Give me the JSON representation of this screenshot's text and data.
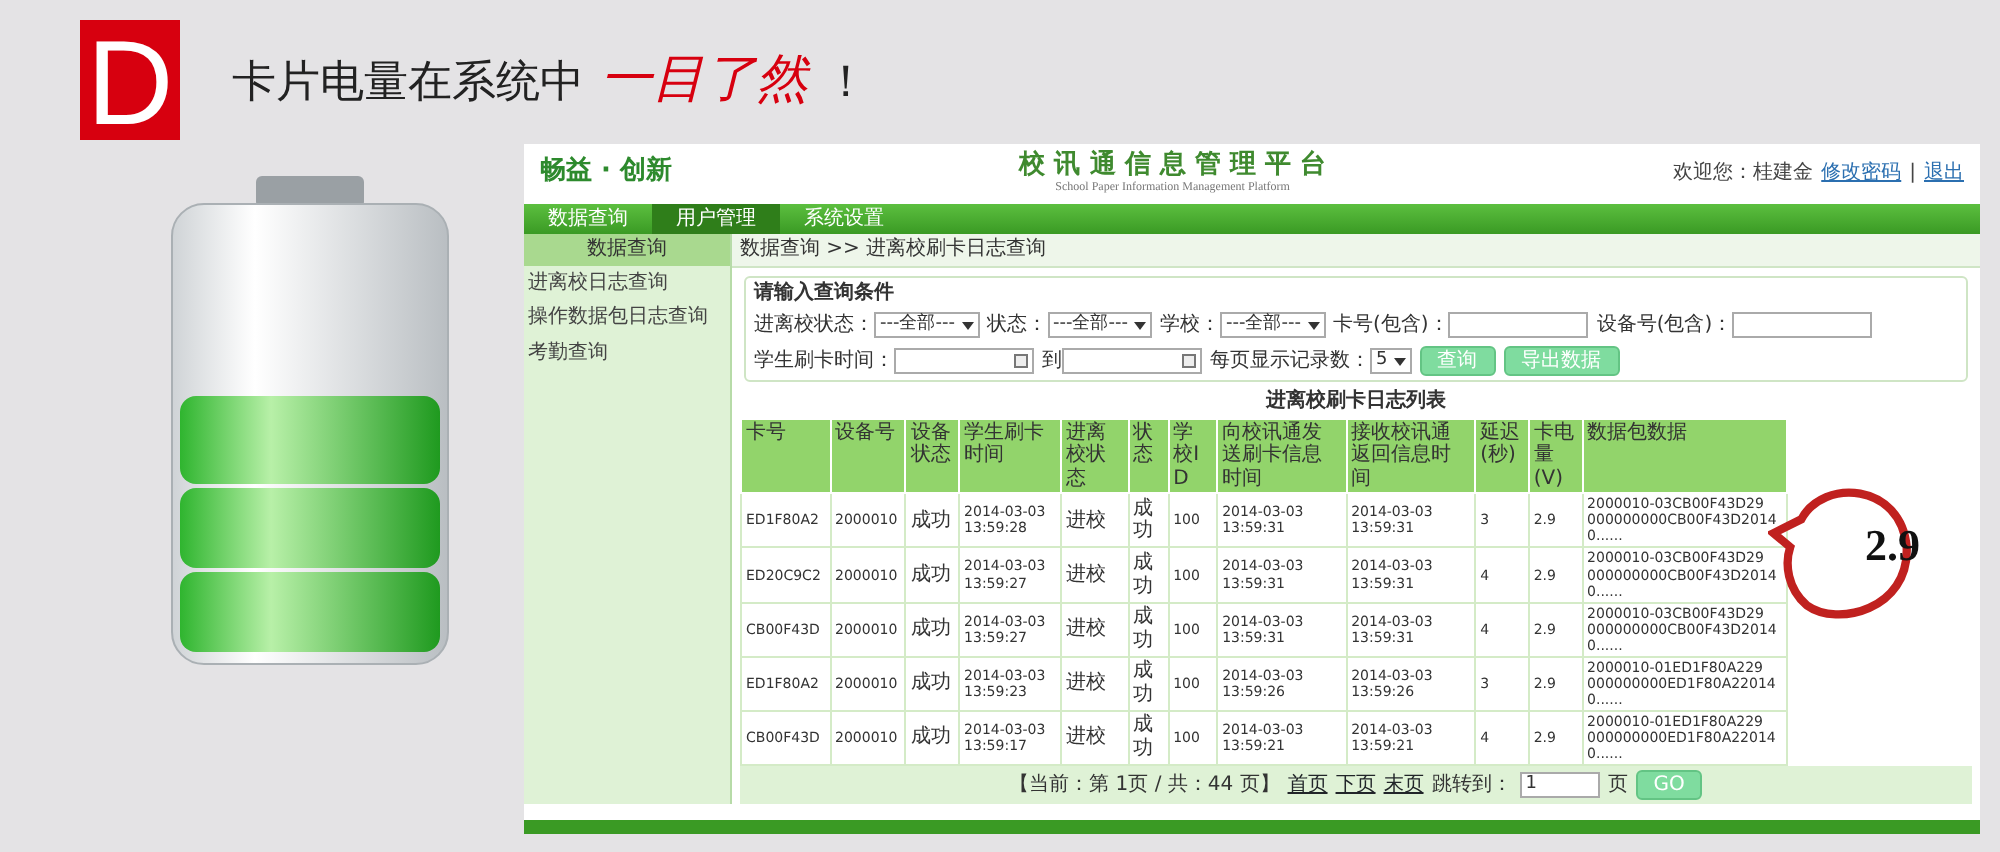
{
  "heading": {
    "badge": "D",
    "text": "卡片电量在系统中",
    "highlight": "一目了然",
    "end": "！"
  },
  "app": {
    "logo": "畅益 · 创新",
    "title": "校 讯 通 信 息 管 理 平 台",
    "subtitle": "School Paper Information Management Platform",
    "welcome": "欢迎您：桂建金",
    "links": [
      "修改密码",
      "退出"
    ],
    "separator": "|",
    "nav": [
      {
        "label": "数据查询",
        "selected": false
      },
      {
        "label": "用户管理",
        "selected": true
      },
      {
        "label": "系统设置",
        "selected": false
      }
    ],
    "sidebar": {
      "title": "数据查询",
      "items": [
        "进离校日志查询",
        "操作数据包日志查询",
        "考勤查询"
      ]
    },
    "breadcrumb": "数据查询 >> 进离校刷卡日志查询",
    "filter": {
      "legend": "请输入查询条件",
      "fields": [
        {
          "kind": "select",
          "label": "进离校状态：",
          "value": "---全部---"
        },
        {
          "kind": "select",
          "label": "状态：",
          "value": "---全部---"
        },
        {
          "kind": "select",
          "label": "学校：",
          "value": "---全部---"
        },
        {
          "kind": "input",
          "label": "卡号(包含)："
        },
        {
          "kind": "input",
          "label": "设备号(包含)："
        },
        {
          "kind": "date",
          "label": "学生刷卡时间："
        },
        {
          "kind": "date",
          "label": "到"
        },
        {
          "kind": "select",
          "label": "每页显示记录数：",
          "value": "5"
        }
      ],
      "buttons": [
        "查询",
        "导出数据"
      ]
    },
    "table": {
      "title": "进离校刷卡日志列表",
      "columns": [
        "卡号",
        "设备号",
        "设备状态",
        "学生刷卡时间",
        "进离校状态",
        "状态",
        "学校ID",
        "向校讯通发送刷卡信息时间",
        "接收校讯通返回信息时间",
        "延迟(秒)",
        "卡电量(V)",
        "数据包数据"
      ],
      "rows": [
        [
          "ED1F80A2",
          "2000010",
          "成功",
          "2014-03-03 13:59:28",
          "进校",
          "成功",
          "100",
          "2014-03-03 13:59:31",
          "2014-03-03 13:59:31",
          "3",
          "2.9",
          "2000010-03CB00F43D29 000000000CB00F43D20140......"
        ],
        [
          "ED20C9C2",
          "2000010",
          "成功",
          "2014-03-03 13:59:27",
          "进校",
          "成功",
          "100",
          "2014-03-03 13:59:31",
          "2014-03-03 13:59:31",
          "4",
          "2.9",
          "2000010-03CB00F43D29 000000000CB00F43D20140......"
        ],
        [
          "CB00F43D",
          "2000010",
          "成功",
          "2014-03-03 13:59:27",
          "进校",
          "成功",
          "100",
          "2014-03-03 13:59:31",
          "2014-03-03 13:59:31",
          "4",
          "2.9",
          "2000010-03CB00F43D29 000000000CB00F43D20140......"
        ],
        [
          "ED1F80A2",
          "2000010",
          "成功",
          "2014-03-03 13:59:23",
          "进校",
          "成功",
          "100",
          "2014-03-03 13:59:26",
          "2014-03-03 13:59:26",
          "3",
          "2.9",
          "2000010-01ED1F80A229 000000000ED1F80A220140......"
        ],
        [
          "CB00F43D",
          "2000010",
          "成功",
          "2014-03-03 13:59:17",
          "进校",
          "成功",
          "100",
          "2014-03-03 13:59:21",
          "2014-03-03 13:59:21",
          "4",
          "2.9",
          "2000010-01ED1F80A229 000000000ED1F80A220140......"
        ]
      ]
    },
    "pager": {
      "info": "【当前：第 1页 / 共：44 页】",
      "links": [
        "首页",
        "下页",
        "末页"
      ],
      "jump_label": "跳转到：",
      "jump_value": "1",
      "unit": "页",
      "go": "GO"
    }
  },
  "annotation": {
    "text": "2.9"
  }
}
